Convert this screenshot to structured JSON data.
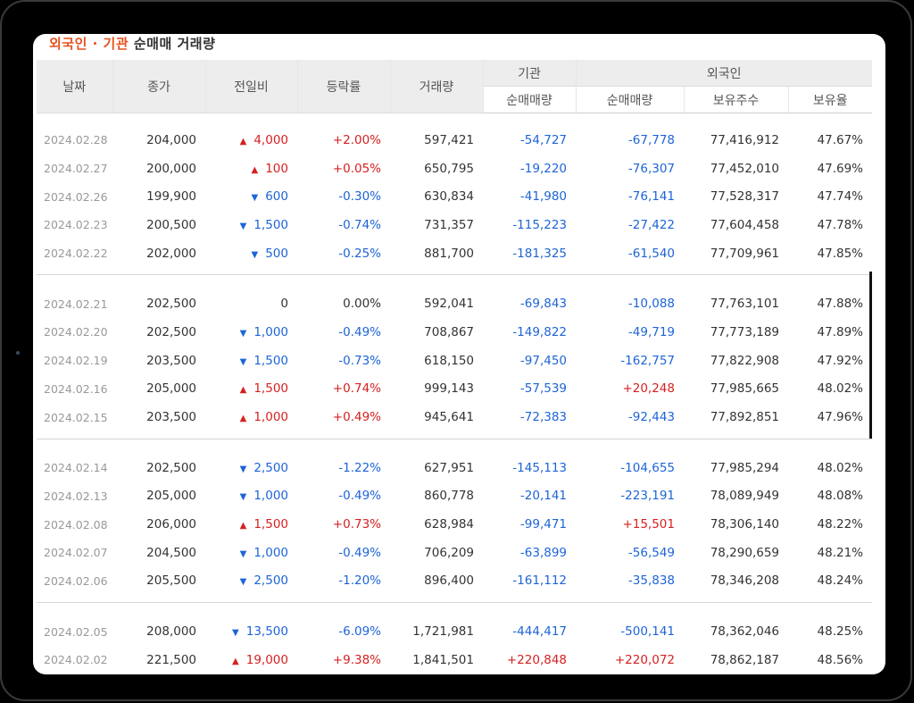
{
  "title": {
    "highlight": "외국인 · 기관",
    "rest": " 순매매 거래량"
  },
  "headers": {
    "date": "날짜",
    "close": "종가",
    "change": "전일비",
    "rate": "등락률",
    "volume": "거래량",
    "institution": "기관",
    "foreign": "외국인",
    "inst_net": "순매매량",
    "foreign_net": "순매매량",
    "foreign_shares": "보유주수",
    "foreign_ratio": "보유율"
  },
  "rows": [
    {
      "date": "2024.02.28",
      "close": "204,000",
      "dir": "up",
      "change": "4,000",
      "rate": "+2.00%",
      "volume": "597,421",
      "inst": "-54,727",
      "foreign": "-67,778",
      "shares": "77,416,912",
      "ratio": "47.67%"
    },
    {
      "date": "2024.02.27",
      "close": "200,000",
      "dir": "up",
      "change": "100",
      "rate": "+0.05%",
      "volume": "650,795",
      "inst": "-19,220",
      "foreign": "-76,307",
      "shares": "77,452,010",
      "ratio": "47.69%"
    },
    {
      "date": "2024.02.26",
      "close": "199,900",
      "dir": "down",
      "change": "600",
      "rate": "-0.30%",
      "volume": "630,834",
      "inst": "-41,980",
      "foreign": "-76,141",
      "shares": "77,528,317",
      "ratio": "47.74%"
    },
    {
      "date": "2024.02.23",
      "close": "200,500",
      "dir": "down",
      "change": "1,500",
      "rate": "-0.74%",
      "volume": "731,357",
      "inst": "-115,223",
      "foreign": "-27,422",
      "shares": "77,604,458",
      "ratio": "47.78%"
    },
    {
      "date": "2024.02.22",
      "close": "202,000",
      "dir": "down",
      "change": "500",
      "rate": "-0.25%",
      "volume": "881,700",
      "inst": "-181,325",
      "foreign": "-61,540",
      "shares": "77,709,961",
      "ratio": "47.85%"
    },
    {
      "date": "2024.02.21",
      "close": "202,500",
      "dir": "none",
      "change": "0",
      "rate": "0.00%",
      "volume": "592,041",
      "inst": "-69,843",
      "foreign": "-10,088",
      "shares": "77,763,101",
      "ratio": "47.88%"
    },
    {
      "date": "2024.02.20",
      "close": "202,500",
      "dir": "down",
      "change": "1,000",
      "rate": "-0.49%",
      "volume": "708,867",
      "inst": "-149,822",
      "foreign": "-49,719",
      "shares": "77,773,189",
      "ratio": "47.89%"
    },
    {
      "date": "2024.02.19",
      "close": "203,500",
      "dir": "down",
      "change": "1,500",
      "rate": "-0.73%",
      "volume": "618,150",
      "inst": "-97,450",
      "foreign": "-162,757",
      "shares": "77,822,908",
      "ratio": "47.92%"
    },
    {
      "date": "2024.02.16",
      "close": "205,000",
      "dir": "up",
      "change": "1,500",
      "rate": "+0.74%",
      "volume": "999,143",
      "inst": "-57,539",
      "foreign": "+20,248",
      "shares": "77,985,665",
      "ratio": "48.02%"
    },
    {
      "date": "2024.02.15",
      "close": "203,500",
      "dir": "up",
      "change": "1,000",
      "rate": "+0.49%",
      "volume": "945,641",
      "inst": "-72,383",
      "foreign": "-92,443",
      "shares": "77,892,851",
      "ratio": "47.96%"
    },
    {
      "date": "2024.02.14",
      "close": "202,500",
      "dir": "down",
      "change": "2,500",
      "rate": "-1.22%",
      "volume": "627,951",
      "inst": "-145,113",
      "foreign": "-104,655",
      "shares": "77,985,294",
      "ratio": "48.02%"
    },
    {
      "date": "2024.02.13",
      "close": "205,000",
      "dir": "down",
      "change": "1,000",
      "rate": "-0.49%",
      "volume": "860,778",
      "inst": "-20,141",
      "foreign": "-223,191",
      "shares": "78,089,949",
      "ratio": "48.08%"
    },
    {
      "date": "2024.02.08",
      "close": "206,000",
      "dir": "up",
      "change": "1,500",
      "rate": "+0.73%",
      "volume": "628,984",
      "inst": "-99,471",
      "foreign": "+15,501",
      "shares": "78,306,140",
      "ratio": "48.22%"
    },
    {
      "date": "2024.02.07",
      "close": "204,500",
      "dir": "down",
      "change": "1,000",
      "rate": "-0.49%",
      "volume": "706,209",
      "inst": "-63,899",
      "foreign": "-56,549",
      "shares": "78,290,659",
      "ratio": "48.21%"
    },
    {
      "date": "2024.02.06",
      "close": "205,500",
      "dir": "down",
      "change": "2,500",
      "rate": "-1.20%",
      "volume": "896,400",
      "inst": "-161,112",
      "foreign": "-35,838",
      "shares": "78,346,208",
      "ratio": "48.24%"
    },
    {
      "date": "2024.02.05",
      "close": "208,000",
      "dir": "down",
      "change": "13,500",
      "rate": "-6.09%",
      "volume": "1,721,981",
      "inst": "-444,417",
      "foreign": "-500,141",
      "shares": "78,362,046",
      "ratio": "48.25%"
    },
    {
      "date": "2024.02.02",
      "close": "221,500",
      "dir": "up",
      "change": "19,000",
      "rate": "+9.38%",
      "volume": "1,841,501",
      "inst": "+220,848",
      "foreign": "+220,072",
      "shares": "78,862,187",
      "ratio": "48.56%"
    }
  ],
  "colors": {
    "up": "#d62020",
    "down": "#1d64d6",
    "title_highlight": "#e6521f"
  },
  "icons": {
    "up": "up-triangle-icon",
    "down": "down-triangle-icon"
  }
}
